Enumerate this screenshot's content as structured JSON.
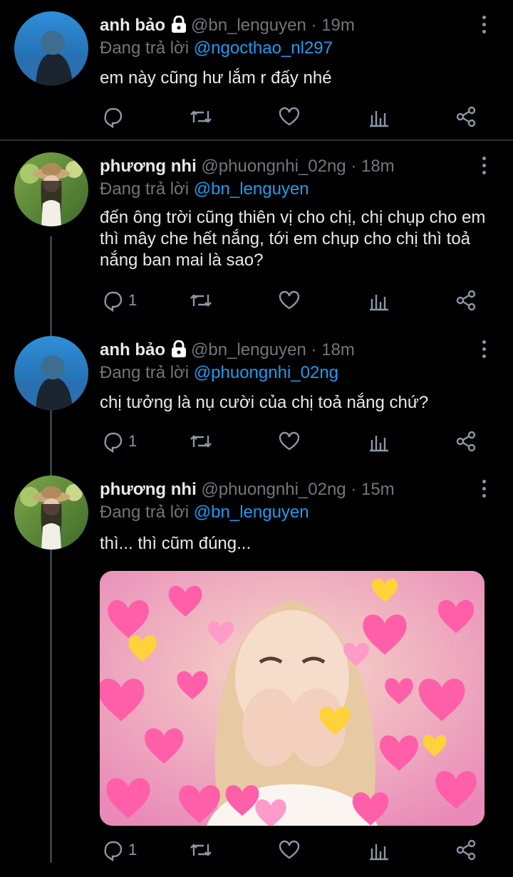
{
  "reply_prefix": "Đang trả lời",
  "tweets": [
    {
      "name": "anh bảo",
      "handle": "@bn_lenguyen",
      "time": "19m",
      "reply_to": "@ngocthao_nl297",
      "text": "em này cũng hư lắm r đấy nhé",
      "reply_count": ""
    },
    {
      "name": "phương nhi",
      "handle": "@phuongnhi_02ng",
      "time": "18m",
      "reply_to": "@bn_lenguyen",
      "text": "đến ông trời cũng thiên vị cho chị, chị chụp cho em thì mây che hết nắng, tới em chụp cho chị thì toả nắng ban mai là sao?",
      "reply_count": "1"
    },
    {
      "name": "anh bảo",
      "handle": "@bn_lenguyen",
      "time": "18m",
      "reply_to": "@phuongnhi_02ng",
      "text": "chị tưởng là nụ cười của chị toả nắng chứ?",
      "reply_count": "1"
    },
    {
      "name": "phương nhi",
      "handle": "@phuongnhi_02ng",
      "time": "15m",
      "reply_to": "@bn_lenguyen",
      "text": "thì... thì cũm đúng...",
      "reply_count": "1"
    }
  ],
  "dot": "·",
  "icons": [
    "lock-icon",
    "more-icon",
    "reply-icon",
    "retweet-icon",
    "like-icon",
    "analytics-icon",
    "share-icon"
  ],
  "colors": {
    "background": "#000000",
    "mention": "#1d9bf0",
    "muted": "#71767b",
    "thread_line": "#3a3f45"
  }
}
